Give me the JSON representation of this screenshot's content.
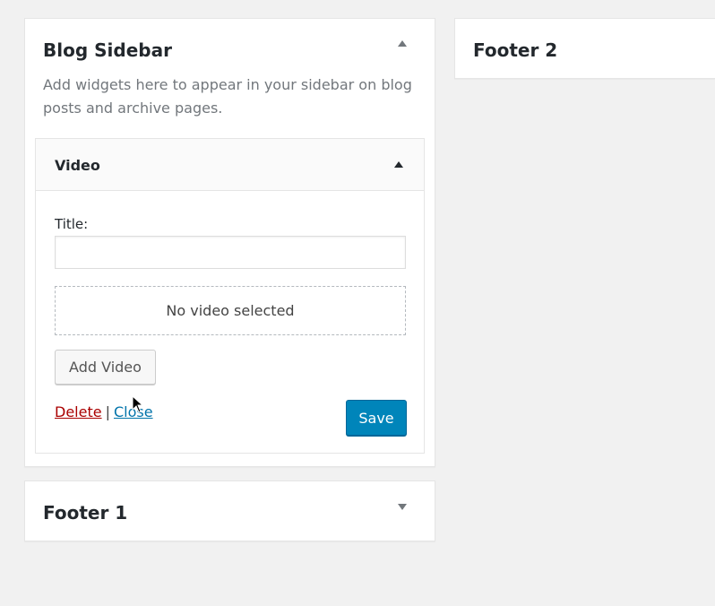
{
  "blog_sidebar": {
    "title": "Blog Sidebar",
    "description": "Add widgets here to appear in your sidebar on blog posts and archive pages.",
    "toggle_icon": "triangle-up-icon",
    "widget": {
      "title": "Video",
      "toggle_icon": "triangle-up-icon",
      "field_label": "Title:",
      "field_value": "",
      "placeholder_text": "No video selected",
      "add_button_label": "Add Video",
      "delete_label": "Delete",
      "separator": "|",
      "close_label": "Close",
      "save_label": "Save"
    }
  },
  "footer_1": {
    "title": "Footer 1",
    "toggle_icon": "triangle-down-icon"
  },
  "footer_2": {
    "title": "Footer 2"
  },
  "colors": {
    "background": "#f1f1f1",
    "save_button": "#0085ba",
    "delete_link": "#aa0000",
    "close_link": "#0073aa"
  },
  "cursor_icon": "mouse-pointer-icon"
}
